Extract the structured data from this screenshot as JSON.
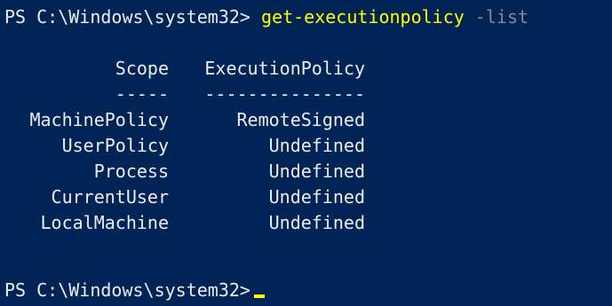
{
  "console": {
    "prompt": "PS C:\\Windows\\system32>",
    "command": "get-executionpolicy",
    "parameter": "-list",
    "colors": {
      "background": "#012456",
      "text": "#eeedf0",
      "command": "#ffff00",
      "parameter": "#8a8a8a",
      "cursor": "#ffff00"
    }
  },
  "table": {
    "headers": {
      "scope": "Scope",
      "policy": "ExecutionPolicy"
    },
    "underlines": {
      "scope": "-----",
      "policy": "---------------"
    },
    "rows": [
      {
        "scope": "MachinePolicy",
        "policy": "RemoteSigned"
      },
      {
        "scope": "UserPolicy",
        "policy": "Undefined"
      },
      {
        "scope": "Process",
        "policy": "Undefined"
      },
      {
        "scope": "CurrentUser",
        "policy": "Undefined"
      },
      {
        "scope": "LocalMachine",
        "policy": "Undefined"
      }
    ]
  },
  "final_prompt": "PS C:\\Windows\\system32>"
}
